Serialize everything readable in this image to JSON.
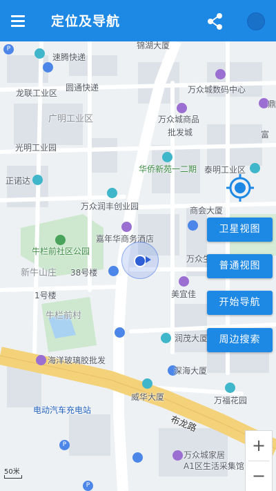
{
  "app_bar": {
    "title": "定位及导航",
    "menu_icon": "menu-icon",
    "share_icon": "share-icon",
    "profile_icon": "profile-icon"
  },
  "map": {
    "labels": {
      "jinhu": "锦湖大厦",
      "suteng": "速腾快递",
      "longlian": "龙联工业区",
      "yuantong": "圆通快递",
      "wanzhong_digital": "万众城数码中心",
      "guangming": "广明工业区",
      "wanzhong_goods": "万众城商品",
      "pifacheng": "批发城",
      "guangming_park": "光明工业园",
      "huaqiao": "华侨新苑一二期",
      "taiming": "泰明工业区",
      "zhengnuoda": "正诺达",
      "wanzhong_runfeng": "万众润丰创业园",
      "shanghui": "商会大厦",
      "jiahua": "嘉年华商务酒店",
      "niulan_park": "牛栏前社区公园",
      "xinniushan": "新牛山庄",
      "building38": "38号楼",
      "wanzhong_super": "万众生活超市",
      "building1": "1号楼",
      "meiyi": "美宜佳",
      "niulan_village": "牛栏前村",
      "runmao": "润茂大厦",
      "haiyang": "海洋玻璃胶批发",
      "shenhai": "深海大厦",
      "weihua": "威华大厦",
      "wanfu": "万福花园",
      "charging": "电动汽车充电站",
      "bulong": "布龙路",
      "wanzhong_home": "万众城家居",
      "a1": "A1区生活采集馆",
      "edge_fu": "富",
      "edge_ding": "鼎"
    },
    "scale_label": "50米"
  },
  "actions": {
    "satellite": "卫星视图",
    "normal": "普通视图",
    "navigate": "开始导航",
    "nearby": "周边搜索"
  },
  "zoom": {
    "in": "+",
    "out": "−"
  }
}
